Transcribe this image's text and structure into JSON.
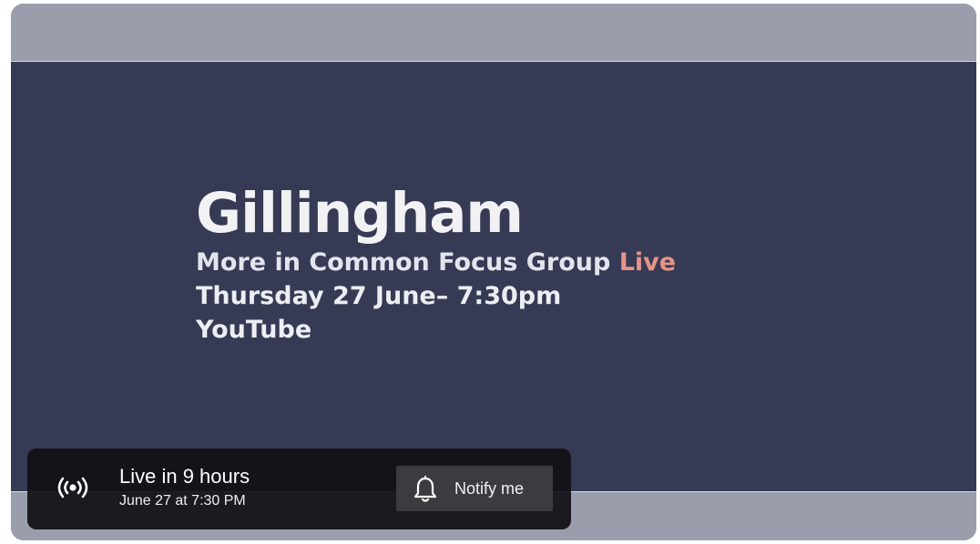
{
  "thumbnail": {
    "title": "Gillingham",
    "subtitle_prefix": "More in Common Focus Group ",
    "subtitle_accent": "Live",
    "date_line": "Thursday 27 June– 7:30pm",
    "platform_line": "YouTube"
  },
  "live_banner": {
    "icon": "live-broadcast-icon",
    "status": "Live in 9 hours",
    "scheduled": "June 27 at 7:30 PM",
    "notify_icon": "bell-icon",
    "notify_label": "Notify me"
  },
  "colors": {
    "thumbnail_bg": "#373a54",
    "accent": "#e59489",
    "banner_bg": "#101014",
    "button_bg": "#3c3c40"
  }
}
